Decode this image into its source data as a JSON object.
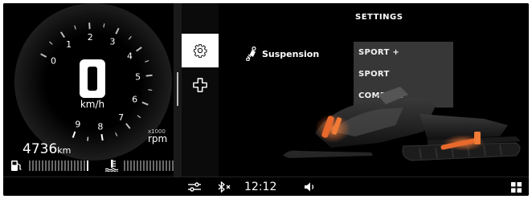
{
  "gauge": {
    "speed": "0",
    "speed_unit": "km/h",
    "rpm_ticks": [
      "0",
      "1",
      "2",
      "3",
      "4",
      "5",
      "6",
      "7",
      "8",
      "9"
    ],
    "rpm_multiplier": "x1000",
    "rpm_label": "rpm",
    "odometer_value": "4736",
    "odometer_unit": "km",
    "fuel_icon": "fuel-pump-icon",
    "temp_icon": "coolant-temperature-icon"
  },
  "side_tabs": [
    {
      "icon": "gear-icon",
      "selected": true
    },
    {
      "icon": "plus-cross-icon",
      "selected": false
    }
  ],
  "settings": {
    "title": "SETTINGS",
    "suspension_icon": "shock-absorber-icon",
    "suspension_label": "Suspension",
    "modes": [
      "SPORT +",
      "SPORT",
      "COMFORT"
    ]
  },
  "status_bar": {
    "settings_icon": "sliders-icon",
    "bluetooth_icon": "bluetooth-off-icon",
    "time": "12:12",
    "volume_icon": "speaker-icon",
    "grid_icon": "app-grid-icon"
  },
  "colors": {
    "background": "#000000",
    "accent": "#e8692b",
    "menu_bg": "#3a3a3a"
  }
}
